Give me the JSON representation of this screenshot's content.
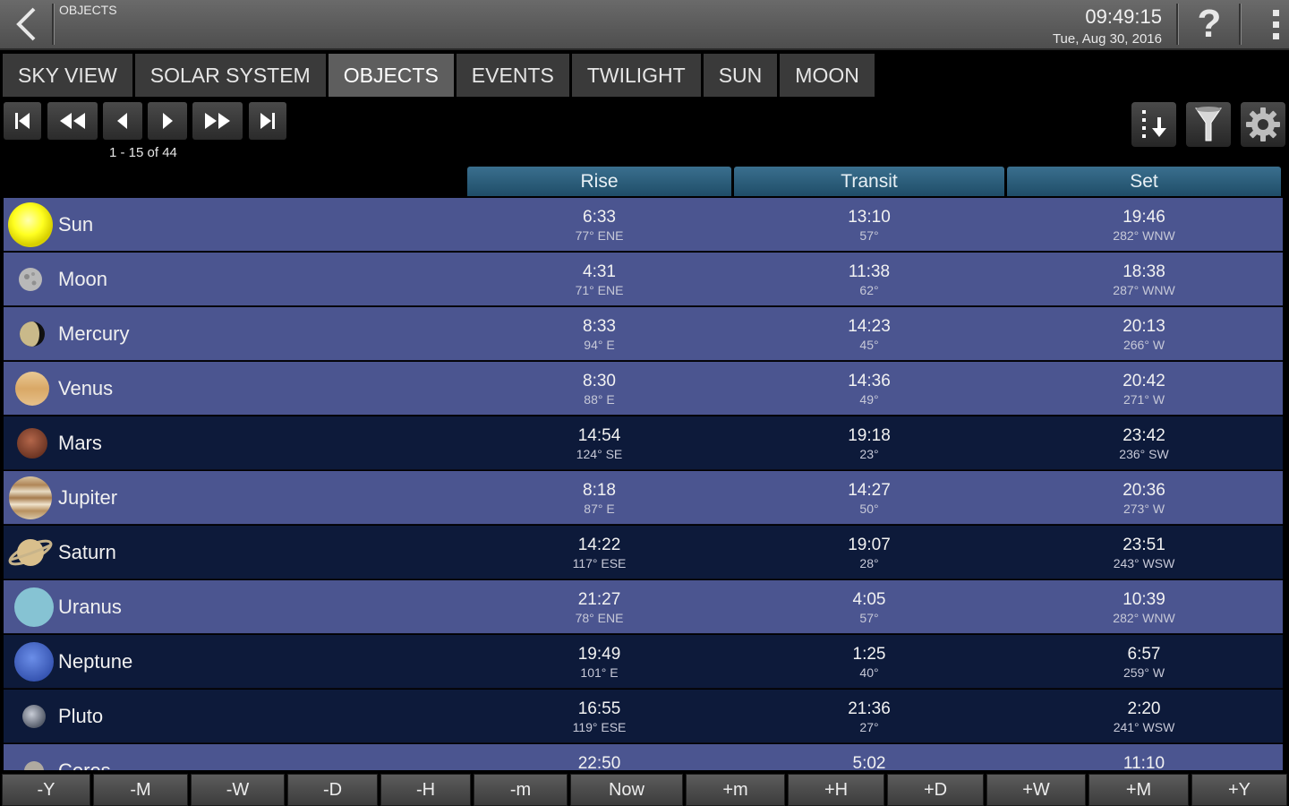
{
  "header": {
    "title": "OBJECTS",
    "time": "09:49:15",
    "date": "Tue, Aug 30, 2016",
    "help_label": "?"
  },
  "tabs": [
    "SKY VIEW",
    "SOLAR SYSTEM",
    "OBJECTS",
    "EVENTS",
    "TWILIGHT",
    "SUN",
    "MOON"
  ],
  "active_tab": "OBJECTS",
  "pager": {
    "count_label": "1 - 15 of 44"
  },
  "columns": {
    "rise": "Rise",
    "transit": "Transit",
    "set": "Set"
  },
  "rows": [
    {
      "name": "Sun",
      "icon": "sun-icon",
      "shade": "light",
      "rise_time": "6:33",
      "rise_az": "77° ENE",
      "transit_time": "13:10",
      "transit_alt": "57°",
      "set_time": "19:46",
      "set_az": "282° WNW"
    },
    {
      "name": "Moon",
      "icon": "moon-icon",
      "shade": "light",
      "rise_time": "4:31",
      "rise_az": "71° ENE",
      "transit_time": "11:38",
      "transit_alt": "62°",
      "set_time": "18:38",
      "set_az": "287° WNW"
    },
    {
      "name": "Mercury",
      "icon": "mercury-icon",
      "shade": "light",
      "rise_time": "8:33",
      "rise_az": "94° E",
      "transit_time": "14:23",
      "transit_alt": "45°",
      "set_time": "20:13",
      "set_az": "266° W"
    },
    {
      "name": "Venus",
      "icon": "venus-icon",
      "shade": "light",
      "rise_time": "8:30",
      "rise_az": "88° E",
      "transit_time": "14:36",
      "transit_alt": "49°",
      "set_time": "20:42",
      "set_az": "271° W"
    },
    {
      "name": "Mars",
      "icon": "mars-icon",
      "shade": "dark",
      "rise_time": "14:54",
      "rise_az": "124° SE",
      "transit_time": "19:18",
      "transit_alt": "23°",
      "set_time": "23:42",
      "set_az": "236° SW"
    },
    {
      "name": "Jupiter",
      "icon": "jupiter-icon",
      "shade": "light",
      "rise_time": "8:18",
      "rise_az": "87° E",
      "transit_time": "14:27",
      "transit_alt": "50°",
      "set_time": "20:36",
      "set_az": "273° W"
    },
    {
      "name": "Saturn",
      "icon": "saturn-icon",
      "shade": "dark",
      "rise_time": "14:22",
      "rise_az": "117° ESE",
      "transit_time": "19:07",
      "transit_alt": "28°",
      "set_time": "23:51",
      "set_az": "243° WSW"
    },
    {
      "name": "Uranus",
      "icon": "uranus-icon",
      "shade": "light",
      "rise_time": "21:27",
      "rise_az": "78° ENE",
      "transit_time": "4:05",
      "transit_alt": "57°",
      "set_time": "10:39",
      "set_az": "282° WNW"
    },
    {
      "name": "Neptune",
      "icon": "neptune-icon",
      "shade": "dark",
      "rise_time": "19:49",
      "rise_az": "101° E",
      "transit_time": "1:25",
      "transit_alt": "40°",
      "set_time": "6:57",
      "set_az": "259° W"
    },
    {
      "name": "Pluto",
      "icon": "pluto-icon",
      "shade": "dark",
      "rise_time": "16:55",
      "rise_az": "119° ESE",
      "transit_time": "21:36",
      "transit_alt": "27°",
      "set_time": "2:20",
      "set_az": "241° WSW"
    },
    {
      "name": "Ceres",
      "icon": "ceres-icon",
      "shade": "light",
      "rise_time": "22:50",
      "rise_az": "",
      "transit_time": "5:02",
      "transit_alt": "",
      "set_time": "11:10",
      "set_az": ""
    }
  ],
  "time_controls": [
    "-Y",
    "-M",
    "-W",
    "-D",
    "-H",
    "-m",
    "Now",
    "+m",
    "+H",
    "+D",
    "+W",
    "+M",
    "+Y"
  ],
  "colors": {
    "row_light": "#4b5590",
    "row_dark": "#0d1a3a",
    "header_blue": "#2b5f7e"
  }
}
